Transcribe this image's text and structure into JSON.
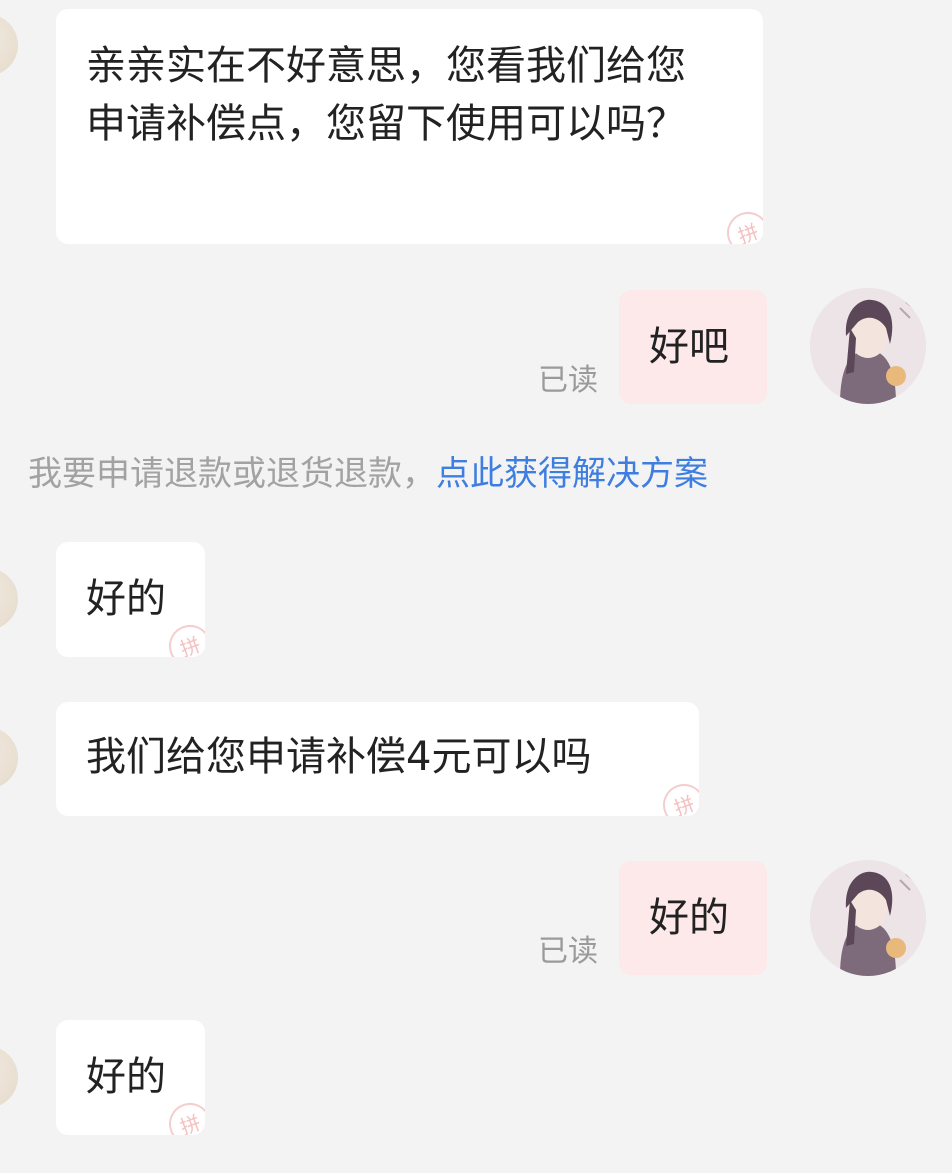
{
  "messages": [
    {
      "side": "merchant",
      "text": "亲亲实在不好意思，您看我们给您申请补偿点，您留下使用可以吗？"
    },
    {
      "side": "user",
      "text": "好吧",
      "status": "已读"
    },
    {
      "side": "merchant",
      "text": "好的"
    },
    {
      "side": "merchant",
      "text": "我们给您申请补偿4元可以吗"
    },
    {
      "side": "user",
      "text": "好的",
      "status": "已读"
    },
    {
      "side": "merchant",
      "text": "好的"
    }
  ],
  "system_notice": {
    "text": "我要申请退款或退货退款，",
    "link_text": "点此获得解决方案"
  },
  "bubble_stamp_char": "拼",
  "colors": {
    "background": "#f3f3f3",
    "merchant_bubble": "#ffffff",
    "user_bubble": "#fde9ea",
    "link": "#3d7ee0",
    "muted_text": "#9a9a9a"
  },
  "icons": {
    "merchant_avatar": "merchant-avatar-icon",
    "user_avatar": "user-avatar-illustration"
  }
}
